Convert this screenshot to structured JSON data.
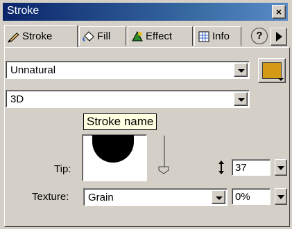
{
  "window": {
    "title": "Stroke",
    "close_glyph": "×"
  },
  "tabs": [
    {
      "label": "Stroke",
      "icon": "brush-icon"
    },
    {
      "label": "Fill",
      "icon": "fill-bucket-icon"
    },
    {
      "label": "Effect",
      "icon": "effect-icon"
    },
    {
      "label": "Info",
      "icon": "info-grid-icon"
    }
  ],
  "help_glyph": "?",
  "stroke_category": {
    "value": "Unnatural"
  },
  "stroke_name": {
    "value": "3D",
    "tooltip": "Stroke name"
  },
  "stroke_color": "#d59a15",
  "tip": {
    "label": "Tip:",
    "size": "37"
  },
  "texture": {
    "label": "Texture:",
    "value": "Grain",
    "amount": "0%"
  }
}
